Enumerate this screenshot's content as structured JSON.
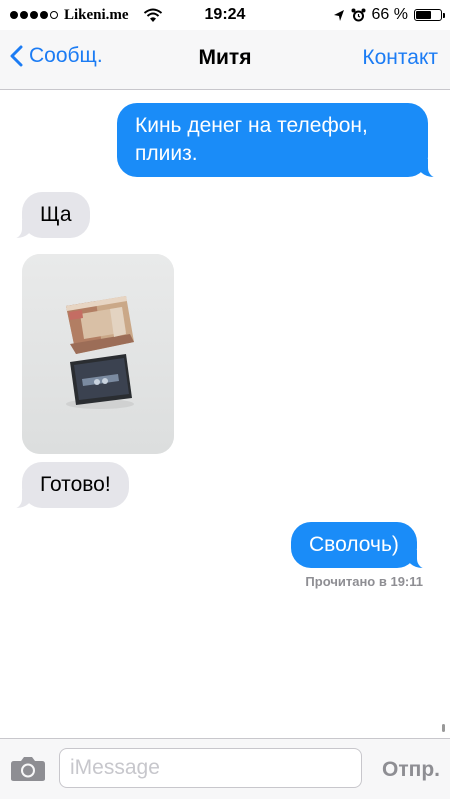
{
  "status_bar": {
    "carrier": "Likeni.me",
    "time": "19:24",
    "battery_percent": "66 %",
    "battery_level": 0.66,
    "icons": [
      "signal-dots",
      "wifi-icon",
      "location-arrow-icon",
      "alarm-icon",
      "battery-icon"
    ]
  },
  "nav": {
    "back_label": "Сообщ.",
    "title": "Митя",
    "contact_label": "Контакт"
  },
  "messages": [
    {
      "direction": "outgoing",
      "text": "Кинь денег на телефон, плииз."
    },
    {
      "direction": "incoming",
      "text": "Ща"
    },
    {
      "direction": "incoming",
      "type": "photo",
      "content": "photo of a banknote on a smartphone"
    },
    {
      "direction": "incoming",
      "text": "Готово!"
    },
    {
      "direction": "outgoing",
      "text": "Сволочь)"
    }
  ],
  "read_receipt": "Прочитано в 19:11",
  "input_bar": {
    "placeholder": "iMessage",
    "send_label": "Отпр."
  },
  "colors": {
    "accent": "#1c7cf4",
    "outgoing_bubble": "#1a8cf8",
    "incoming_bubble": "#e5e5ea"
  }
}
